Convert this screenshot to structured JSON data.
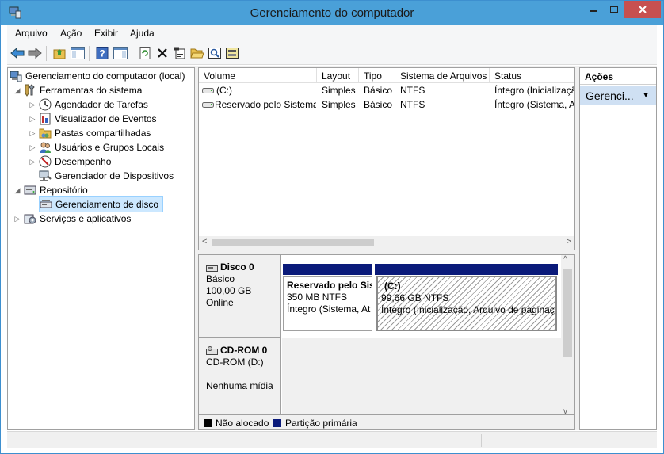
{
  "window": {
    "title": "Gerenciamento do computador"
  },
  "menu": [
    "Arquivo",
    "Ação",
    "Exibir",
    "Ajuda"
  ],
  "toolbar_icons": [
    "back-arrow-icon",
    "forward-arrow-icon",
    "up-folder-icon",
    "show-hide-tree-icon",
    "help-icon",
    "show-hide-action-pane-icon",
    "refresh-icon",
    "delete-icon",
    "properties-icon",
    "open-folder-icon",
    "search-disk-icon",
    "disk-settings-icon"
  ],
  "tree": {
    "root": "Gerenciamento do computador (local)",
    "system_tools": "Ferramentas do sistema",
    "task_scheduler": "Agendador de Tarefas",
    "event_viewer": "Visualizador de Eventos",
    "shared_folders": "Pastas compartilhadas",
    "local_users": "Usuários e Grupos Locais",
    "performance": "Desempenho",
    "device_manager": "Gerenciador de Dispositivos",
    "storage": "Repositório",
    "disk_management": "Gerenciamento de disco",
    "services": "Serviços e aplicativos"
  },
  "volumes": {
    "headers": [
      "Volume",
      "Layout",
      "Tipo",
      "Sistema de Arquivos",
      "Status"
    ],
    "rows": [
      [
        "(C:)",
        "Simples",
        "Básico",
        "NTFS",
        "Íntegro (Inicializaçã"
      ],
      [
        "Reservado pelo Sistema",
        "Simples",
        "Básico",
        "NTFS",
        "Íntegro (Sistema, At"
      ]
    ]
  },
  "disks": {
    "disk0": {
      "name": "Disco 0",
      "type": "Básico",
      "size": "100,00 GB",
      "state": "Online"
    },
    "cdrom0": {
      "name": "CD-ROM 0",
      "type": "CD-ROM (D:)",
      "media": "Nenhuma mídia"
    },
    "partitions": {
      "reserved": {
        "name": "Reservado pelo Sis",
        "size": "350 MB NTFS",
        "status": "Íntegro (Sistema, At"
      },
      "c": {
        "name": "(C:)",
        "size": "99,66 GB NTFS",
        "status": "Íntegro (Inicialização, Arquivo de paginaç"
      }
    }
  },
  "legend": {
    "unallocated": "Não alocado",
    "primary": "Partição primária"
  },
  "colors": {
    "unallocated": "#000000",
    "primary": "#0a1a7a",
    "titlebar": "#4aa0d8",
    "close": "#c75050"
  },
  "actions": {
    "header": "Ações",
    "item": "Gerenci..."
  }
}
